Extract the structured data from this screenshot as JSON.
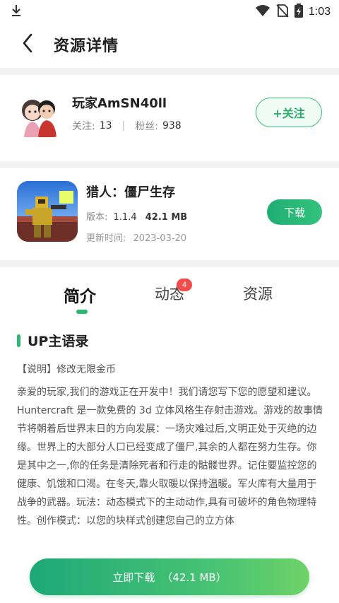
{
  "status_bar": {
    "time": "1:03"
  },
  "header": {
    "title": "资源详情"
  },
  "author": {
    "name": "玩家AmSN40ll",
    "following_label": "关注:",
    "following_count": "13",
    "separator": "|",
    "fans_label": "粉丝:",
    "fans_count": "938",
    "follow_button": "+关注"
  },
  "game": {
    "name": "猎人：僵尸生存",
    "version_label": "版本:",
    "version": "1.1.4",
    "size": "42.1 MB",
    "update_label": "更新时间:",
    "update_date": "2023-03-20",
    "download_button": "下载"
  },
  "tabs": [
    {
      "label": "简介",
      "active": true
    },
    {
      "label": "动态",
      "badge": "4"
    },
    {
      "label": "资源"
    }
  ],
  "section": {
    "title": "UP主语录",
    "note": "【说明】修改无限金币",
    "description": "亲爱的玩家,我们的游戏正在开发中！我们请您写下您的愿望和建议。Huntercraft 是一款免费的 3d 立体风格生存射击游戏。游戏的故事情节将朝着后世界末日的方向发展：一场灾难过后,文明正处于灭绝的边缘。世界上的大部分人口已经变成了僵尸,其余的人都在努力生存。你是其中之一,你的任务是清除死者和行走的骷髅世界。记住要监控您的健康、饥饿和口渴。在冬天,靠火取暖以保持温暖。军火库有大量用于战争的武器。玩法：动态模式下的主动动作,具有可破坏的角色物理特性。创作模式：以您的块样式创建您自己的立方体"
  },
  "bottom": {
    "download_label": "立即下载",
    "download_size": "（42.1 MB）"
  },
  "colors": {
    "accent": "#2fb673",
    "badge": "#f24d4d"
  },
  "icons": [
    "download-icon",
    "wifi-icon",
    "no-sim-icon",
    "battery-icon",
    "back-arrow-icon"
  ]
}
